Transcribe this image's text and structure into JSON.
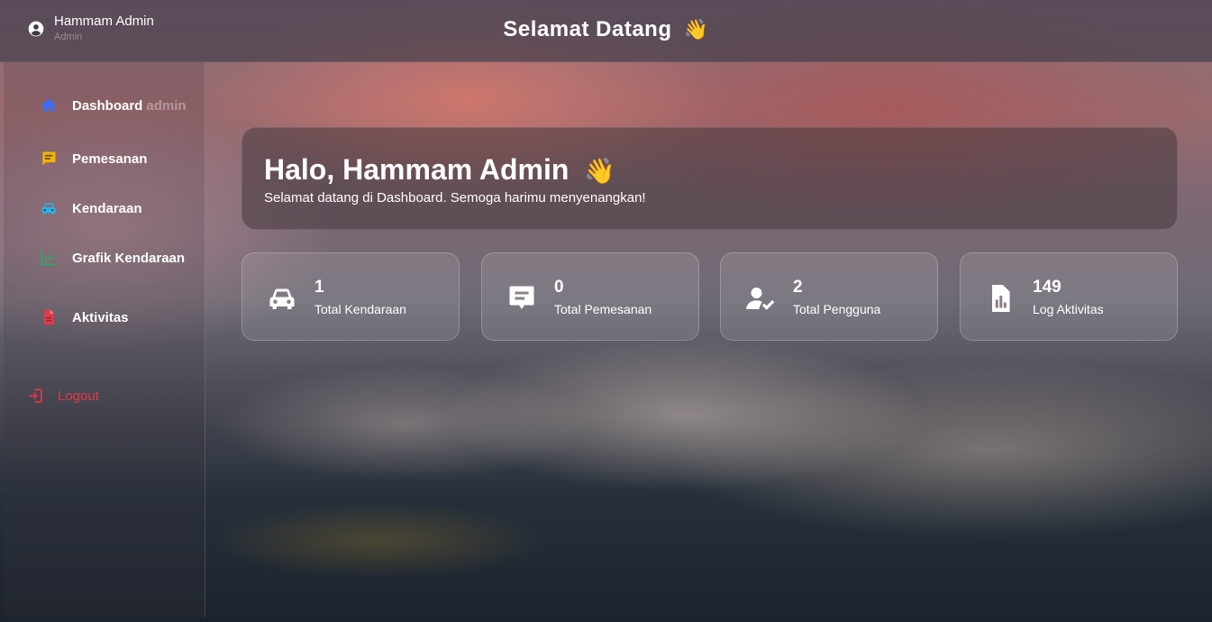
{
  "header": {
    "user_name": "Hammam Admin",
    "user_role": "Admin",
    "title": "Selamat Datang",
    "title_emoji": "👋"
  },
  "sidebar": {
    "items": [
      {
        "label": "Dashboard",
        "suffix": "admin",
        "icon": "home-icon",
        "color": "#3b6ff5"
      },
      {
        "label": "Pemesanan",
        "icon": "message-icon",
        "color": "#f5b301"
      },
      {
        "label": "Kendaraan",
        "icon": "car-icon",
        "color": "#26b5e8"
      },
      {
        "label": "Grafik Kendaraan",
        "icon": "chart-line-icon",
        "color": "#2ea86b"
      },
      {
        "label": "Aktivitas",
        "icon": "file-icon",
        "color": "#e0394a"
      }
    ],
    "logout_label": "Logout",
    "logout_color": "#e0394a"
  },
  "welcome": {
    "heading": "Halo, Hammam Admin",
    "emoji": "👋",
    "subtitle": "Selamat datang di Dashboard. Semoga harimu menyenangkan!"
  },
  "stats": [
    {
      "value": "1",
      "label": "Total Kendaraan",
      "icon": "car-icon"
    },
    {
      "value": "0",
      "label": "Total Pemesanan",
      "icon": "message-icon"
    },
    {
      "value": "2",
      "label": "Total Pengguna",
      "icon": "user-check-icon"
    },
    {
      "value": "149",
      "label": "Log Aktivitas",
      "icon": "report-file-icon"
    }
  ]
}
